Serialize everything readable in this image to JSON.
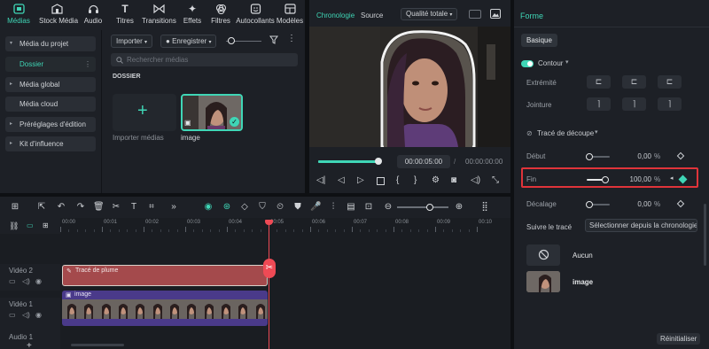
{
  "toolbar": {
    "tabs": [
      {
        "label": "Médias",
        "icon": "media-icon",
        "active": true
      },
      {
        "label": "Stock Média",
        "icon": "stock-icon"
      },
      {
        "label": "Audio",
        "icon": "audio-icon"
      },
      {
        "label": "Titres",
        "icon": "titles-icon"
      },
      {
        "label": "Transitions",
        "icon": "transitions-icon"
      },
      {
        "label": "Effets",
        "icon": "effects-icon"
      },
      {
        "label": "Filtres",
        "icon": "filters-icon"
      },
      {
        "label": "Autocollants",
        "icon": "stickers-icon"
      },
      {
        "label": "Modèles",
        "icon": "templates-icon"
      }
    ]
  },
  "library": {
    "items": [
      {
        "label": "Média du projet",
        "caret": "▾"
      },
      {
        "label": "Dossier",
        "selected": true
      },
      {
        "label": "Média global",
        "caret": "▸"
      },
      {
        "label": "Média cloud"
      },
      {
        "label": "Préréglages d'édition",
        "caret": "▸"
      },
      {
        "label": "Kit d'influence",
        "caret": "▸"
      }
    ]
  },
  "media": {
    "import_label": "Importer",
    "record_label": "Enregistrer",
    "search_placeholder": "Rechercher médias",
    "section_title": "DOSSIER",
    "import_tile_label": "Importer médias",
    "clip_label": "image"
  },
  "preview": {
    "tab_chronologie": "Chronologie",
    "tab_source": "Source",
    "quality_label": "Qualité totale",
    "current_time": "00:00:05:00",
    "total_time": "00:00:00:00",
    "progress": 0.97
  },
  "props": {
    "panel_title": "Forme",
    "tab_basic": "Basique",
    "contour_label": "Contour",
    "contour_enabled": true,
    "extremite_label": "Extrémité",
    "jointure_label": "Jointure",
    "trace_label": "Tracé de découpe",
    "debut_label": "Début",
    "debut_value": "0,00",
    "debut_unit": "%",
    "fin_label": "Fin",
    "fin_value": "100,00",
    "fin_unit": "%",
    "decalage_label": "Décalage",
    "decalage_value": "0,00",
    "decalage_unit": "%",
    "suivre_label": "Suivre le tracé",
    "suivre_value": "Sélectionner depuis la chronologie",
    "option_none": "Aucun",
    "option_image": "image",
    "reset_label": "Réinitialiser",
    "highlight_color": "#e0343a",
    "accent_color": "#3fd6b6"
  },
  "timeline": {
    "ruler": [
      "00:00",
      "00:01",
      "00:02",
      "00:03",
      "00:04",
      "00:05",
      "00:06",
      "00:07",
      "00:08",
      "00:09",
      "00:10"
    ],
    "tracks": [
      {
        "name": "Vidéo 2",
        "clip": "Tracé de plume"
      },
      {
        "name": "Vidéo 1",
        "clip": "image"
      },
      {
        "name": "Audio 1"
      }
    ]
  }
}
